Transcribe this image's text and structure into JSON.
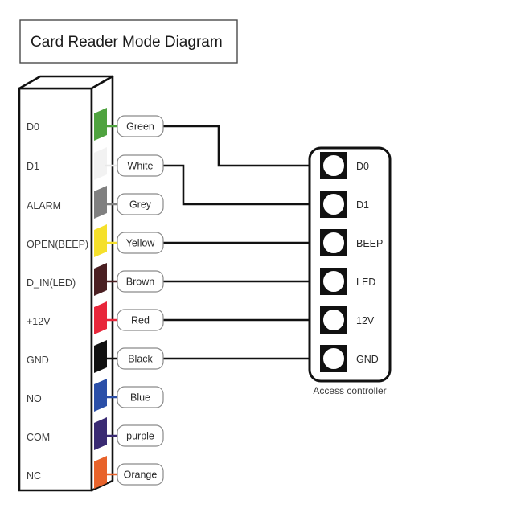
{
  "title": {
    "text": "Card Reader Mode Diagram"
  },
  "card_reader": {
    "name": "Card Reader",
    "pins": [
      {
        "label": "D0",
        "color_name": "Green",
        "color": "#4fa33f",
        "connects_to": "D0"
      },
      {
        "label": "D1",
        "color_name": "White",
        "color": "#f2f2f2",
        "connects_to": "D1"
      },
      {
        "label": "ALARM",
        "color_name": "Grey",
        "color": "#808080",
        "connects_to": ""
      },
      {
        "label": "OPEN(BEEP)",
        "color_name": "Yellow",
        "color": "#f5e02b",
        "connects_to": "BEEP"
      },
      {
        "label": "D_IN(LED)",
        "color_name": "Brown",
        "color": "#4a1f22",
        "connects_to": "LED"
      },
      {
        "label": "+12V",
        "color_name": "Red",
        "color": "#e8263a",
        "connects_to": "12V"
      },
      {
        "label": "GND",
        "color_name": "Black",
        "color": "#111111",
        "connects_to": "GND"
      },
      {
        "label": "NO",
        "color_name": "Blue",
        "color": "#2b4fa8",
        "connects_to": ""
      },
      {
        "label": "COM",
        "color_name": "purple",
        "color": "#3a2b73",
        "connects_to": ""
      },
      {
        "label": "NC",
        "color_name": "Orange",
        "color": "#e8632b",
        "connects_to": ""
      }
    ]
  },
  "controller": {
    "caption": "Access controller",
    "terminals": [
      {
        "label": "D0"
      },
      {
        "label": "D1"
      },
      {
        "label": "BEEP"
      },
      {
        "label": "LED"
      },
      {
        "label": "12V"
      },
      {
        "label": "GND"
      }
    ]
  },
  "style": {
    "line": "#111111",
    "outline": "#111111",
    "pill_border": "#8a8a8a",
    "pill_fill": "#ffffff",
    "text": "#3d3d3d"
  }
}
